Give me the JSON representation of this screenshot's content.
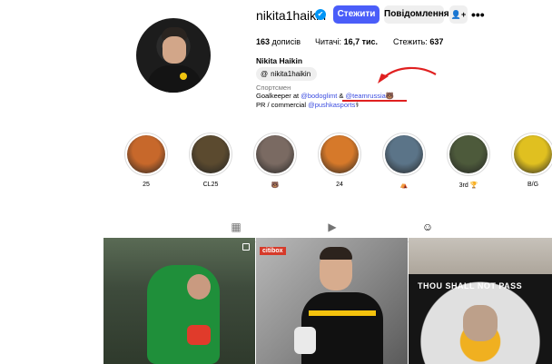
{
  "profile": {
    "username": "nikita1haikin",
    "follow_label": "Стежити",
    "message_label": "Повідомлення",
    "posts_count": "163",
    "posts_label": "дописів",
    "followers_label": "Читачі:",
    "followers_count": "16,7 тис.",
    "following_label": "Стежить:",
    "following_count": "637",
    "full_name": "Nikita Haikin",
    "threads_handle": "nikita1haikin",
    "category": "Спортсмен",
    "bio_line1_prefix": "Goalkeeper at ",
    "bio_mention1": "@bodoglimt",
    "bio_and": " & ",
    "bio_mention2": "@teamrussia",
    "bio_emoji": "🐻",
    "bio_line2_prefix": "PR / commercial ",
    "bio_mention3": "@pushkasports",
    "bio_emoji2": "⚕"
  },
  "highlights": [
    {
      "label": "25",
      "color": "#c7682b"
    },
    {
      "label": "CL25",
      "color": "#5b4a2f"
    },
    {
      "label": "🐻",
      "color": "#7a6a62"
    },
    {
      "label": "24",
      "color": "#d6792a"
    },
    {
      "label": "⛺",
      "color": "#5b7488"
    },
    {
      "label": "3rd 🏆",
      "color": "#4d5a3b"
    },
    {
      "label": "B/G",
      "color": "#e0c020"
    }
  ],
  "post2_brand": "citibox",
  "post3_text": "THOU SHALL NOT PASS",
  "icons": {
    "verified": "verified-badge-icon",
    "add_person": "add-person-icon",
    "more": "more-icon",
    "threads": "threads-icon",
    "grid": "grid-icon",
    "reels": "reels-icon",
    "tagged": "tagged-icon"
  }
}
